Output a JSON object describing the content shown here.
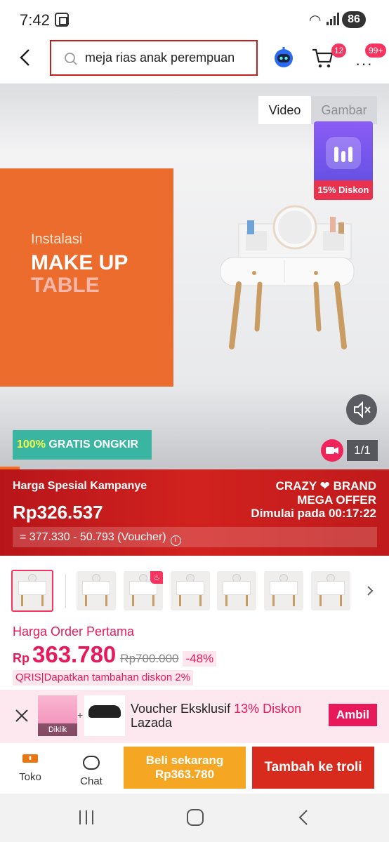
{
  "status_bar": {
    "time": "7:42",
    "battery": "86"
  },
  "header": {
    "search_text": "meja rias anak perempuan",
    "cart_count": "12",
    "more_count": "99+"
  },
  "media": {
    "tabs": {
      "video": "Video",
      "gambar": "Gambar"
    },
    "discount_badge": "15% Diskon",
    "panel": {
      "line1": "Instalasi",
      "line2": "MAKE UP",
      "line3": "TABLE"
    },
    "free_shipping": {
      "highlight": "100%",
      "rest": " GRATIS ONGKIR"
    },
    "page_indicator": "1/1",
    "progress": 0.05
  },
  "campaign": {
    "label": "Harga Spesial Kampanye",
    "price": "Rp326.537",
    "brand_line1_a": "CRAZY",
    "brand_line1_b": "BRAND",
    "brand_line2": "MEGA OFFER",
    "timer": "Dimulai pada 00:17:22",
    "voucher_breakdown": "= 377.330 - 50.793 (Voucher)"
  },
  "price": {
    "first_order_label": "Harga Order Pertama",
    "currency": "Rp",
    "value": "363.780",
    "original": "Rp700.000",
    "discount": "-48%",
    "qris": "QRIS|Dapatkan tambahan diskon 2%"
  },
  "voucher_banner": {
    "image_label": "Diklik",
    "title_prefix": "Voucher Eksklusif ",
    "title_highlight": "13% Diskon",
    "title_line2": "Lazada",
    "button": "Ambil"
  },
  "actions": {
    "store_label": "Toko",
    "chat_label": "Chat",
    "buy_now_line1": "Beli sekarang",
    "buy_now_line2": "Rp363.780",
    "add_to_cart": "Tambah ke troli"
  },
  "colors": {
    "accent": "#e8195a",
    "campaign_red": "#d1221f",
    "buy_orange": "#f5a623",
    "cart_red": "#d92a1e"
  }
}
